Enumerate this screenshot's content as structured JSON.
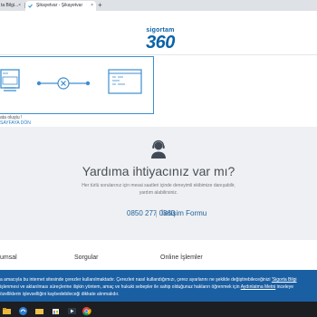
{
  "browser": {
    "tabs": [
      {
        "label": "ta Bilgi...",
        "close": "×"
      },
      {
        "label": "Şikayetvar - Şikayetvar",
        "close": "×"
      }
    ],
    "new_tab": "+"
  },
  "logo": {
    "top": "sigortam",
    "number": "360"
  },
  "error": {
    "text": "ata oluştu !",
    "link": "SAYFAYA DÖN"
  },
  "help": {
    "title": "Yardıma ihtiyacınız var mı?",
    "description": "Her türlü sorularınız için mesai saatleri içinde deneyimli ekibimize danışabilir, yardım alabilirsiniz.",
    "phone": "0850 277 0360",
    "contact_form": "İletişim Formu"
  },
  "footer_nav": {
    "items": [
      "umsal",
      "Sorgular",
      "Online İşlemler"
    ]
  },
  "cookie": {
    "line1": "a amacıyla bu internet sitesinde çerezler kullanılmaktadır. Çerezleri nasıl kullandığımızı, çerez ayarlarını ne şekilde değiştirebileceğinizi ",
    "link1": "'Sigorta Bilgi",
    "line2": "işlenmesi ve aktarılması süreçlerine ilişkin yöntem, amaç ve hukuki sebepler ile sahip olduğunuz hakların öğrenmek için ",
    "link2": "Aydınlatma Metni",
    "line2_end": " inceleye",
    "line3": "özelliklerin işlevselliğini kaybedebileceği dikkate alınmalıdır."
  },
  "colors": {
    "brand": "#0b63a8",
    "cookie_bg": "#1b5fa3",
    "help_bg": "#eef0f3",
    "link": "#1f5f99"
  },
  "taskbar": {
    "icons": [
      "file-explorer-icon",
      "edge-icon",
      "folder-icon",
      "store-icon",
      "media-icon",
      "chrome-icon"
    ]
  }
}
